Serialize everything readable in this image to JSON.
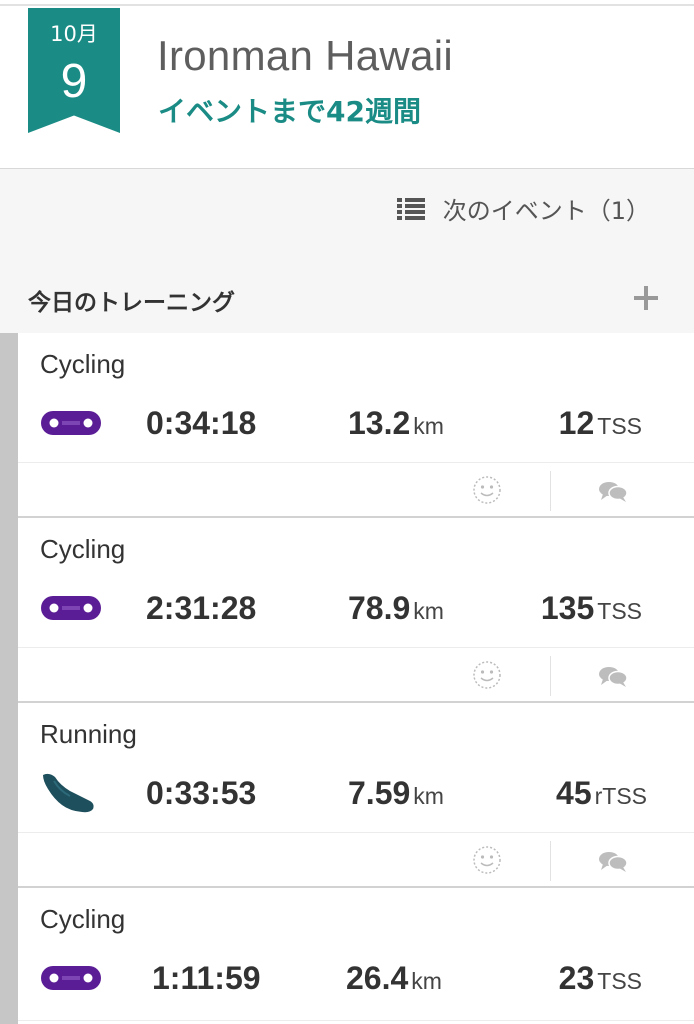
{
  "event": {
    "month": "10月",
    "day": "9",
    "title": "Ironman Hawaii",
    "countdown": "イベントまで42週間",
    "accent_color": "#1b8c85"
  },
  "next_events": {
    "icon": "list-icon",
    "label": "次のイベント（1）"
  },
  "section": {
    "title": "今日のトレーニング",
    "add_icon": "plus-icon"
  },
  "workouts": [
    {
      "sport": "Cycling",
      "icon": "bike-chain-icon",
      "duration": "0:34:18",
      "distance": "13.2",
      "distance_unit": "km",
      "score": "12",
      "score_unit": "TSS"
    },
    {
      "sport": "Cycling",
      "icon": "bike-chain-icon",
      "duration": "2:31:28",
      "distance": "78.9",
      "distance_unit": "km",
      "score": "135",
      "score_unit": "TSS"
    },
    {
      "sport": "Running",
      "icon": "running-shoe-icon",
      "duration": "0:33:53",
      "distance": "7.59",
      "distance_unit": "km",
      "score": "45",
      "score_unit": "rTSS"
    },
    {
      "sport": "Cycling",
      "icon": "bike-chain-icon",
      "duration": "1:11:59",
      "distance": "26.4",
      "distance_unit": "km",
      "score": "23",
      "score_unit": "TSS"
    }
  ],
  "colors": {
    "cycling_icon": "#5b1d96",
    "running_icon": "#1e4f5c",
    "left_bar": "#c6c6c6"
  }
}
